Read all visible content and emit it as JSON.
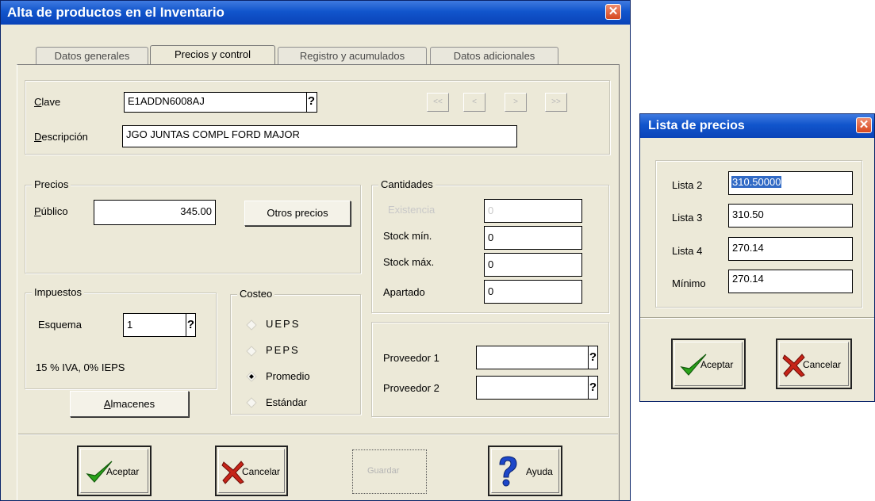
{
  "main_window": {
    "title": "Alta de productos en el Inventario",
    "close": "✕",
    "tabs": [
      "Datos generales",
      "Precios y control",
      "Registro y acumulados",
      "Datos adicionales"
    ],
    "active_tab": "Precios y control",
    "clave_label": "Clave",
    "clave_value": "E1ADDN6008AJ",
    "help_mark": "?",
    "nav_buttons": [
      "<<",
      "<",
      ">",
      ">>"
    ],
    "descripcion_label": "Descripción",
    "descripcion_value": "JGO JUNTAS COMPL FORD MAJOR",
    "precios": {
      "legend": "Precios",
      "publico_label": "Público",
      "publico_value": "345.00",
      "otros_button": "Otros precios"
    },
    "cantidades": {
      "legend": "Cantidades",
      "existencia_label": "Existencia",
      "existencia_value": "0",
      "stock_min_label": "Stock mín.",
      "stock_min_value": "0",
      "stock_max_label": "Stock máx.",
      "stock_max_value": "0",
      "apartado_label": "Apartado",
      "apartado_value": "0"
    },
    "impuestos": {
      "legend": "Impuestos",
      "esquema_label": "Esquema",
      "esquema_value": "1",
      "summary": "15 % IVA, 0% IEPS"
    },
    "costeo": {
      "legend": "Costeo",
      "options": [
        "UEPS",
        "PEPS",
        "Promedio",
        "Estándar"
      ],
      "selected": "Promedio"
    },
    "proveedores": {
      "proveedor1_label": "Proveedor 1",
      "proveedor2_label": "Proveedor 2"
    },
    "almacenes_button": "Almacenes",
    "footer": {
      "aceptar": "Aceptar",
      "cancelar": "Cancelar",
      "disabled_button": "Guardar",
      "ayuda": "Ayuda"
    }
  },
  "price_window": {
    "title": "Lista de precios",
    "close": "✕",
    "rows": [
      {
        "label": "Lista 2",
        "value": "310.50000"
      },
      {
        "label": "Lista 3",
        "value": "310.50"
      },
      {
        "label": "Lista 4",
        "value": "270.14"
      },
      {
        "label": "Mínimo",
        "value": "270.14"
      }
    ],
    "aceptar": "Aceptar",
    "cancelar": "Cancelar"
  },
  "colors": {
    "title_blue": "#1155cc",
    "window_bg": "#ece9d8",
    "check_green": "#2aa31a",
    "cancel_red": "#c62418",
    "help_blue": "#1d47c9"
  },
  "icons": [
    "close-icon",
    "checkmark-icon",
    "cancel-x-icon",
    "help-question-icon"
  ]
}
